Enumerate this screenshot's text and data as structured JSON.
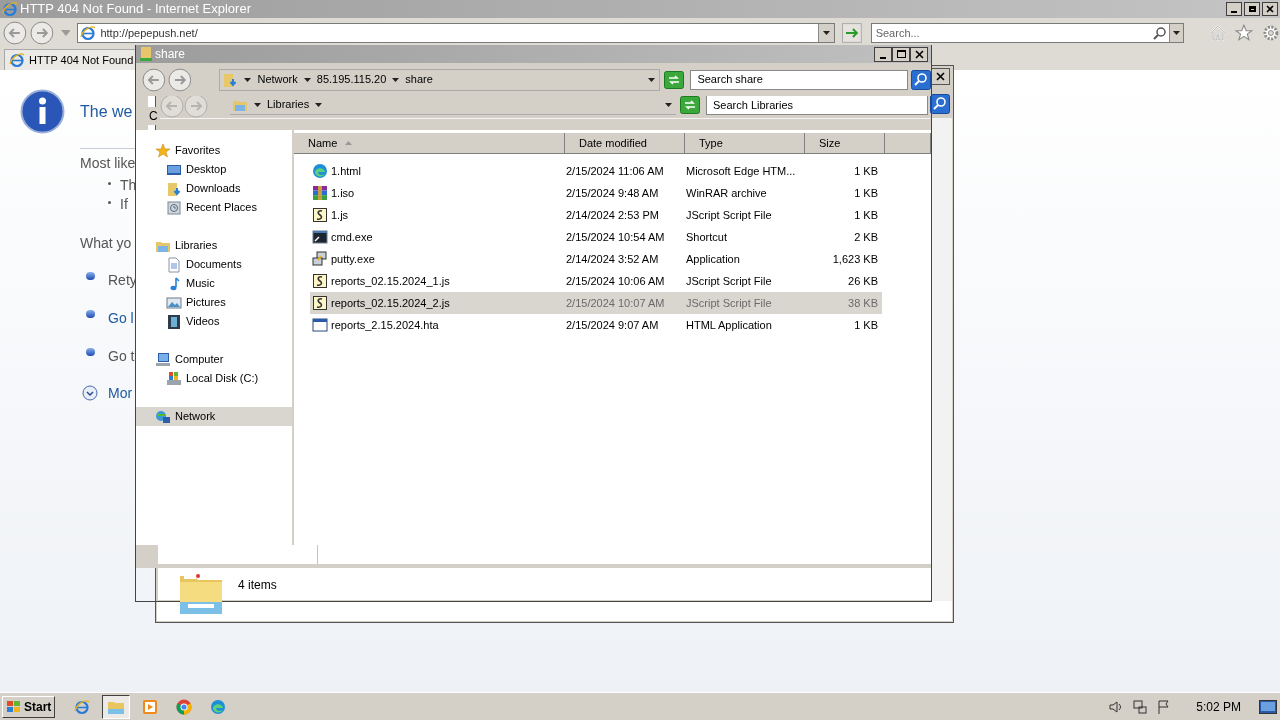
{
  "browser": {
    "title": "HTTP 404 Not Found - Internet Explorer",
    "address": "http://pepepush.net/",
    "search_placeholder": "Search...",
    "tab": "HTTP 404 Not Found",
    "page": {
      "heading": "The we",
      "intro": "Most like",
      "bullets": [
        "Th",
        "If"
      ],
      "prompt": "What yo",
      "actions": [
        {
          "text": "Rety",
          "kind": "text"
        },
        {
          "text": "Go l",
          "kind": "link"
        },
        {
          "text": "Go t",
          "kind": "text"
        }
      ],
      "more": "Mor"
    }
  },
  "back_window": {
    "fragment": "C",
    "breadcrumb": "Libraries",
    "search_placeholder": "Search Libraries"
  },
  "window": {
    "title": "share",
    "breadcrumb": [
      "Network",
      "85.195.115.20",
      "share"
    ],
    "search_placeholder": "Search share",
    "nav": [
      {
        "label": "Favorites",
        "kind": "star",
        "selected": false,
        "children": [
          {
            "label": "Desktop",
            "kind": "desktop",
            "selected": false
          },
          {
            "label": "Downloads",
            "kind": "downloads",
            "selected": false
          },
          {
            "label": "Recent Places",
            "kind": "recent",
            "selected": false
          }
        ]
      },
      {
        "label": "Libraries",
        "kind": "library",
        "selected": false,
        "children": [
          {
            "label": "Documents",
            "kind": "document",
            "selected": false
          },
          {
            "label": "Music",
            "kind": "music",
            "selected": false
          },
          {
            "label": "Pictures",
            "kind": "pictures",
            "selected": false
          },
          {
            "label": "Videos",
            "kind": "videos",
            "selected": false
          }
        ]
      },
      {
        "label": "Computer",
        "kind": "computer",
        "selected": false,
        "children": [
          {
            "label": "Local Disk (C:)",
            "kind": "disk",
            "selected": false
          }
        ]
      },
      {
        "label": "Network",
        "kind": "network",
        "selected": true
      }
    ],
    "columns": [
      {
        "label": "Name",
        "sorted": true
      },
      {
        "label": "Date modified",
        "sorted": false
      },
      {
        "label": "Type",
        "sorted": false
      },
      {
        "label": "Size",
        "sorted": false
      }
    ],
    "files": [
      {
        "name": "1.html",
        "date": "2/15/2024 11:06 AM",
        "type": "Microsoft Edge HTM...",
        "size": "1 KB",
        "kind": "edge",
        "selected": false
      },
      {
        "name": "1.iso",
        "date": "2/15/2024 9:48 AM",
        "type": "WinRAR archive",
        "size": "1 KB",
        "kind": "archive",
        "selected": false
      },
      {
        "name": "1.js",
        "date": "2/14/2024 2:53 PM",
        "type": "JScript Script File",
        "size": "1 KB",
        "kind": "script",
        "selected": false
      },
      {
        "name": "cmd.exe",
        "date": "2/15/2024 10:54 AM",
        "type": "Shortcut",
        "size": "2 KB",
        "kind": "shortcut",
        "selected": false
      },
      {
        "name": "putty.exe",
        "date": "2/14/2024 3:52 AM",
        "type": "Application",
        "size": "1,623 KB",
        "kind": "app",
        "selected": false
      },
      {
        "name": "reports_02.15.2024_1.js",
        "date": "2/15/2024 10:06 AM",
        "type": "JScript Script File",
        "size": "26 KB",
        "kind": "script",
        "selected": false
      },
      {
        "name": "reports_02.15.2024_2.js",
        "date": "2/15/2024 10:07 AM",
        "type": "JScript Script File",
        "size": "38 KB",
        "kind": "script",
        "selected": true
      },
      {
        "name": "reports_2.15.2024.hta",
        "date": "2/15/2024 9:07 AM",
        "type": "HTML Application",
        "size": "1 KB",
        "kind": "hta",
        "selected": false
      }
    ],
    "status": "4 items"
  },
  "taskbar": {
    "start": "Start",
    "apps": [
      {
        "kind": "ie",
        "active": false
      },
      {
        "kind": "explorer",
        "active": true
      },
      {
        "kind": "media",
        "active": false
      },
      {
        "kind": "chrome",
        "active": false
      },
      {
        "kind": "edge",
        "active": false
      }
    ],
    "clock": "5:02 PM"
  }
}
